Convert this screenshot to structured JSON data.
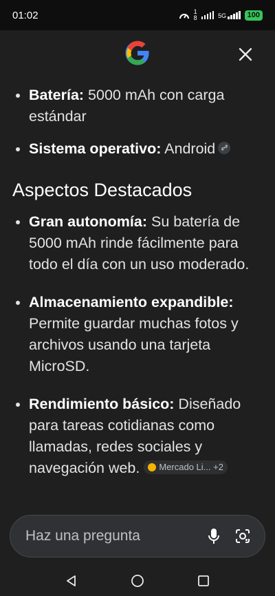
{
  "status_bar": {
    "time": "01:02",
    "net_top": "1",
    "net_mid": "8",
    "network_type": "5G",
    "battery": "100",
    "icons": [
      "speedometer-icon",
      "signal-bars-icon",
      "5g-signal-icon",
      "battery-icon"
    ]
  },
  "header": {
    "logo": "google-g-logo",
    "close_icon": "close-icon"
  },
  "specs": [
    {
      "label": "Batería:",
      "text": " 5000 mAh con carga estándar"
    },
    {
      "label": "Sistema operativo:",
      "text": " Android"
    }
  ],
  "link_chip_icon": "link-icon",
  "section": {
    "title": "Aspectos Destacados"
  },
  "highlights": [
    {
      "label": "Gran autonomía:",
      "text": " Su batería de 5000 mAh rinde fácilmente para todo el día con un uso moderado."
    },
    {
      "label": "Almacenamiento expandible:",
      "text": " Permite guardar muchas fotos y archivos usando una tarjeta MicroSD."
    },
    {
      "label": "Rendimiento básico:",
      "text": " Diseñado para tareas cotidianas como llamadas, redes sociales y navegación web."
    }
  ],
  "inline_source": {
    "label": "Mercado Li... +2"
  },
  "ask_bar": {
    "placeholder": "Haz una pregunta",
    "mic_icon": "microphone-icon",
    "lens_icon": "camera-lens-icon"
  },
  "nav_bar": {
    "icons": [
      "back-triangle-icon",
      "home-circle-icon",
      "recents-square-icon"
    ]
  },
  "colors": {
    "background": "#1f1f1f",
    "status_bar": "#0e0e0e",
    "text": "#e3e3e3",
    "battery": "#34c759",
    "google_blue": "#4285f4",
    "google_red": "#ea4335",
    "google_yellow": "#fbbc05",
    "google_green": "#34a853"
  }
}
